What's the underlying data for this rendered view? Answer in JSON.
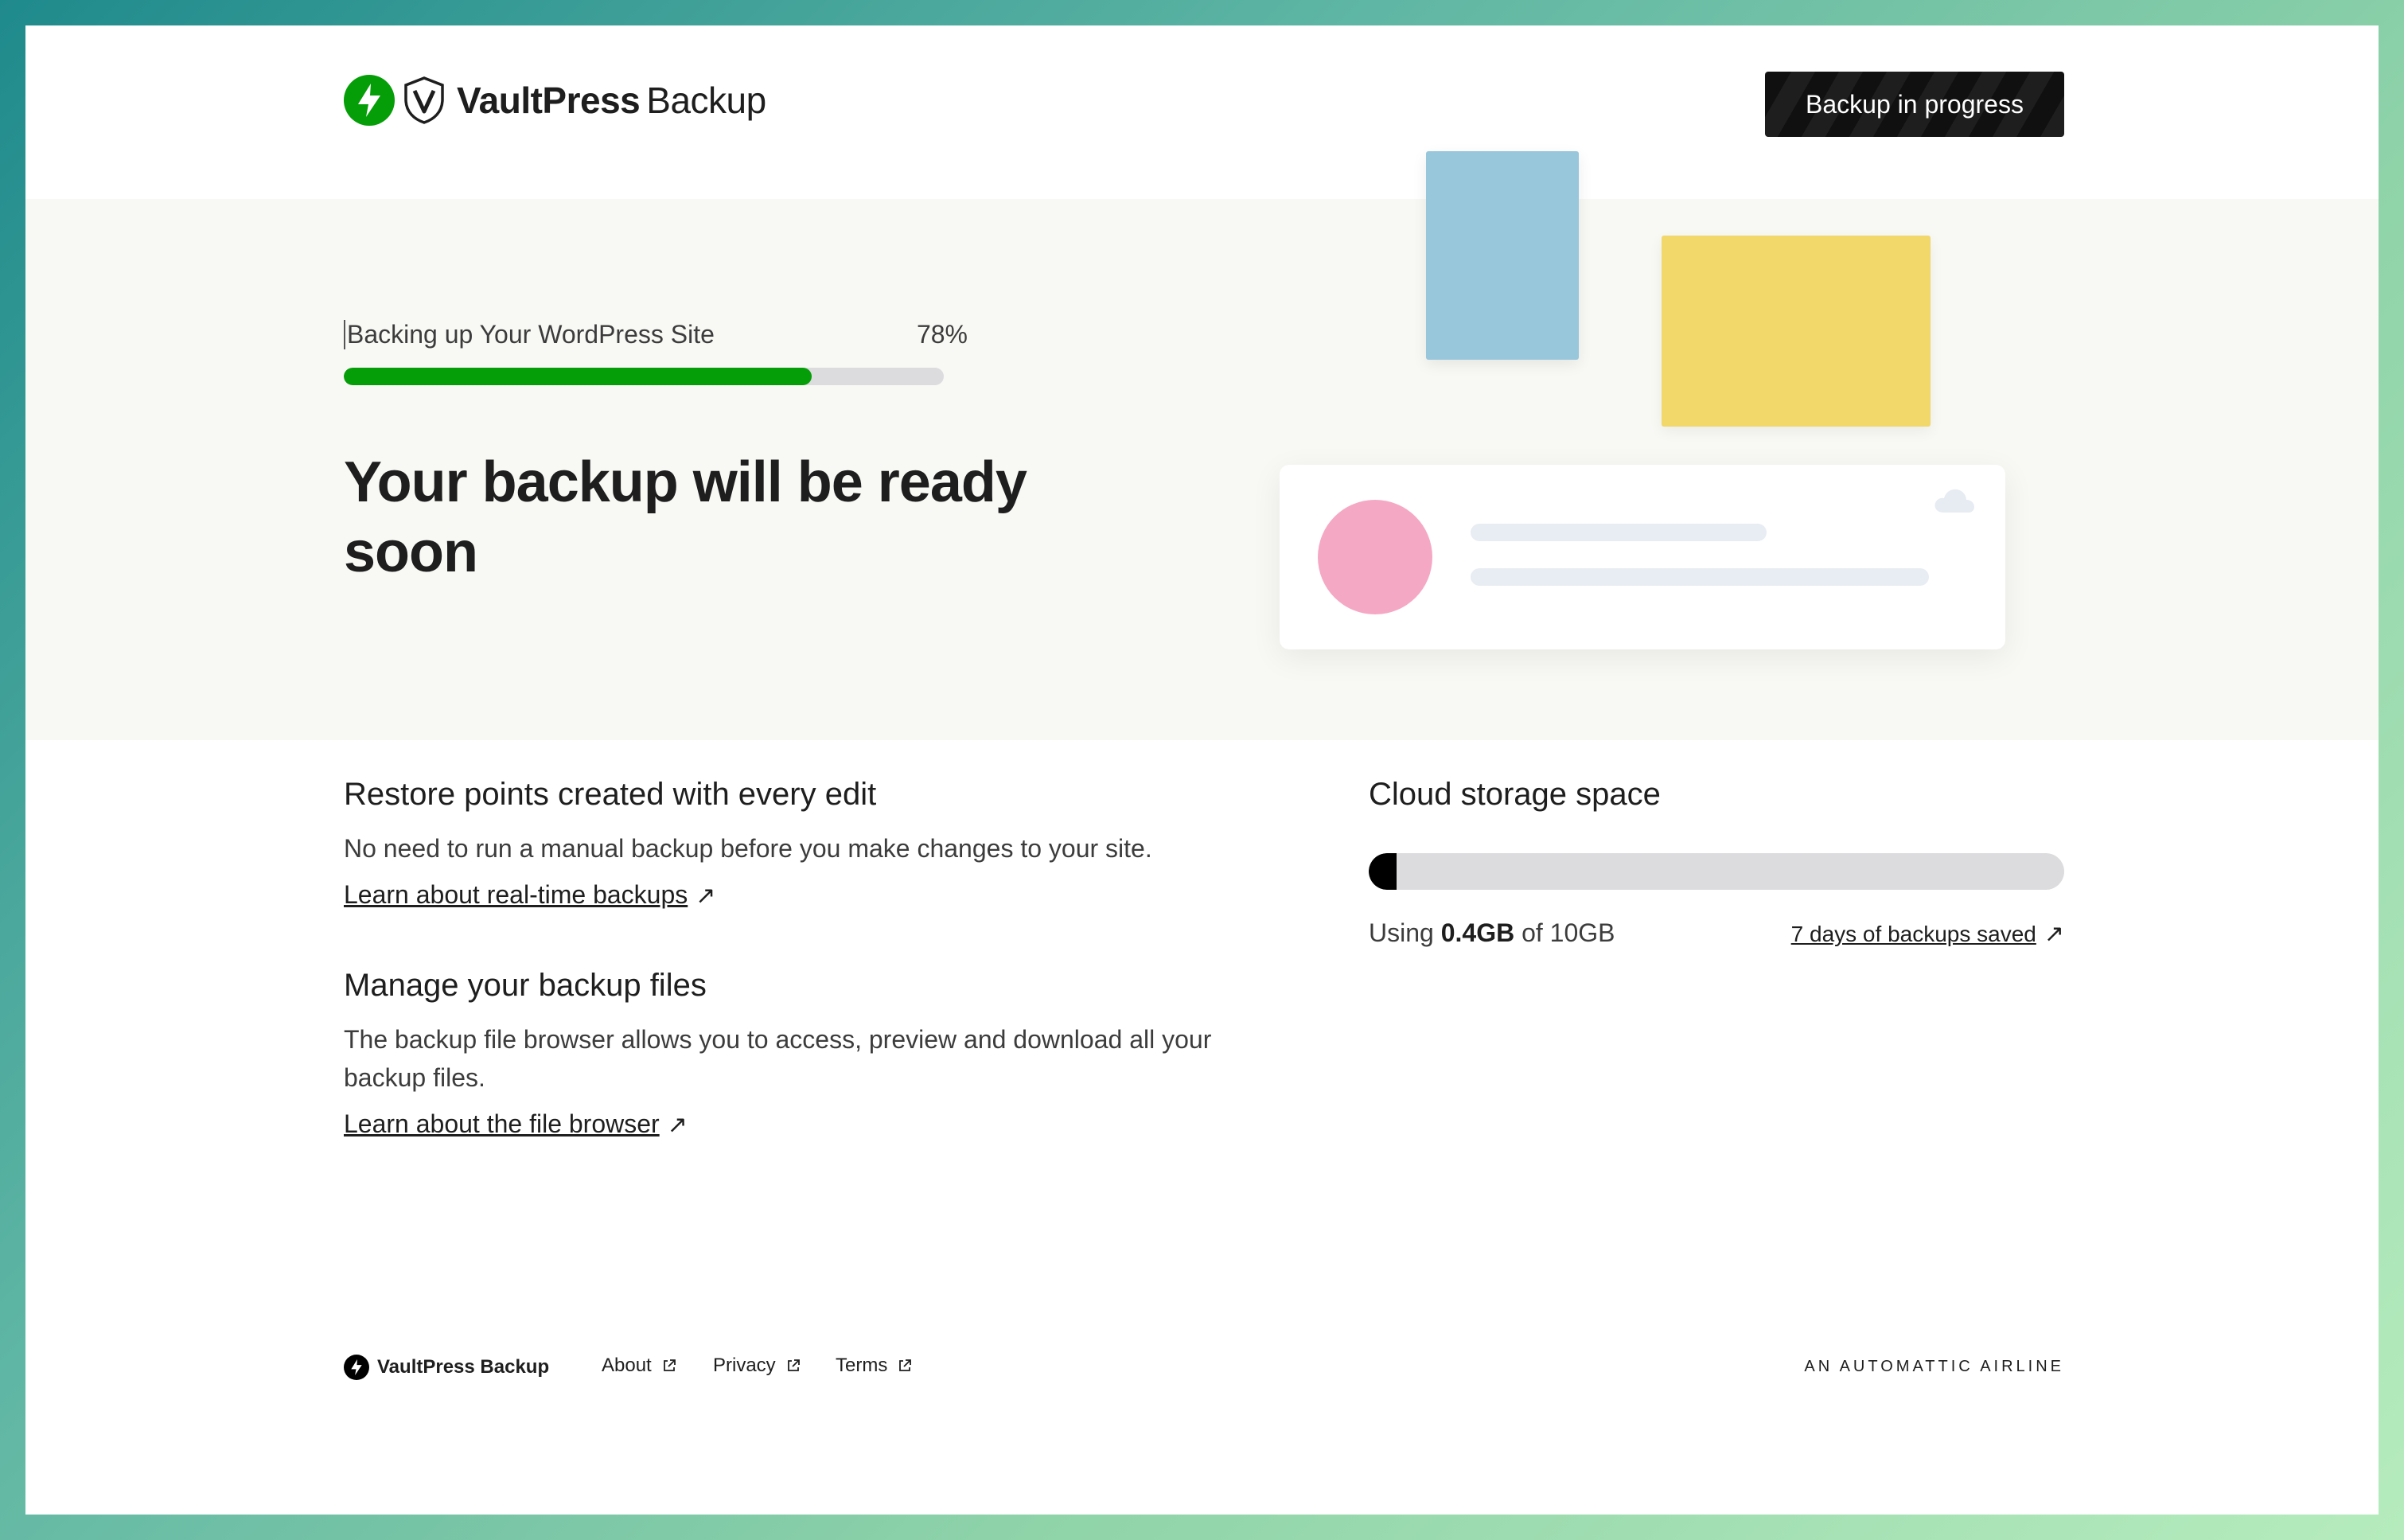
{
  "header": {
    "logo_brand": "VaultPress",
    "logo_product": "Backup",
    "status_button": "Backup in progress"
  },
  "hero": {
    "progress_label": "Backing up Your WordPress Site",
    "progress_percent_text": "78%",
    "progress_value": 0.78,
    "headline": "Your backup will be ready soon"
  },
  "features": [
    {
      "title": "Restore points created with every edit",
      "description": "No need to run a manual backup before you make changes to your site.",
      "link": "Learn about real-time backups"
    },
    {
      "title": "Manage your backup files",
      "description": "The backup file browser allows you to access, preview and download all your backup files.",
      "link": "Learn about the file browser"
    }
  ],
  "storage": {
    "title": "Cloud storage space",
    "usage_prefix": "Using",
    "usage_used": "0.4GB",
    "usage_suffix": "of 10GB",
    "used_fraction": 0.04,
    "link": "7 days of backups saved"
  },
  "footer": {
    "brand": "VaultPress Backup",
    "links": [
      "About",
      "Privacy",
      "Terms"
    ],
    "tagline": "AN AUTOMATTIC AIRLINE"
  },
  "colors": {
    "accent_green": "#069e08",
    "hero_bg": "#f8f8f4",
    "card_blue": "#98c6da",
    "card_yellow": "#f2d76b",
    "avatar_pink": "#f5a8c4"
  }
}
